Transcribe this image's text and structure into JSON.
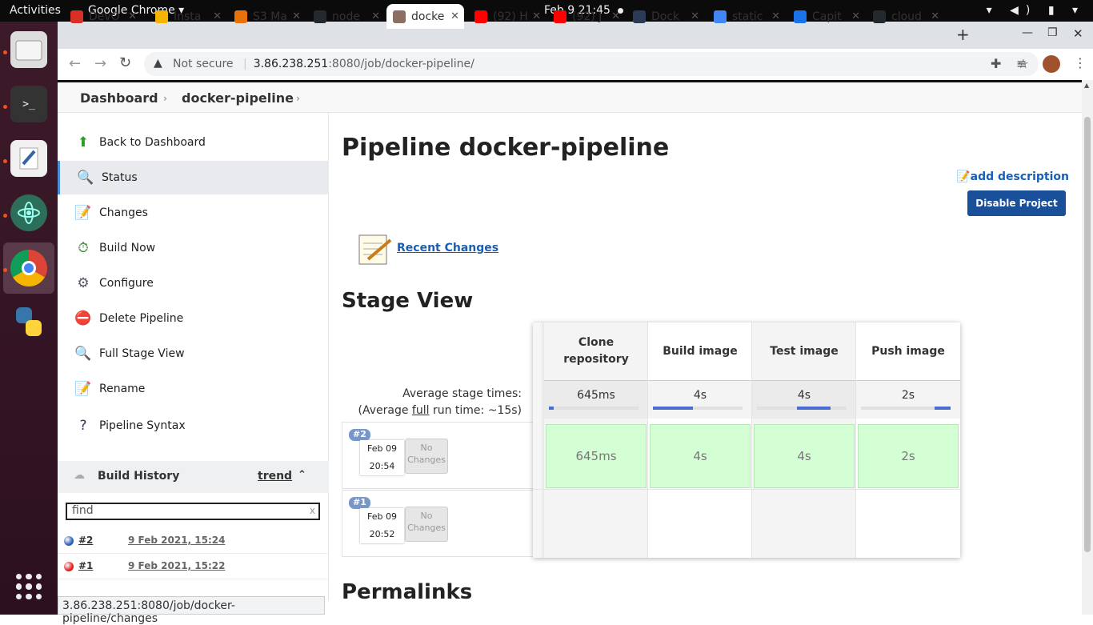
{
  "topbar": {
    "activities": "Activities",
    "app": "Google Chrome ▾",
    "clock": "Feb 9  21:45",
    "sys": "▾ ◀) ▮ ▾"
  },
  "tabs": [
    {
      "label": "DevO",
      "color": "#d93025"
    },
    {
      "label": "Insta",
      "color": "#f4b400"
    },
    {
      "label": "S3 Ma",
      "color": "#e8710a"
    },
    {
      "label": "node",
      "color": "#24292e"
    },
    {
      "label": "docke",
      "color": "#8d6e63"
    },
    {
      "label": "(92) H",
      "color": "#ff0000"
    },
    {
      "label": "(92) J",
      "color": "#ff0000"
    },
    {
      "label": "Dock",
      "color": "#2b3a55"
    },
    {
      "label": "static",
      "color": "#4285f4"
    },
    {
      "label": "Capit",
      "color": "#1a73e8"
    },
    {
      "label": "cloud",
      "color": "#24292e"
    }
  ],
  "address": {
    "not_secure": "Not secure",
    "host": "3.86.238.251",
    "path": ":8080/job/docker-pipeline/"
  },
  "breadcrumb": {
    "dashboard": "Dashboard",
    "job": "docker-pipeline"
  },
  "sidebar": [
    {
      "label": "Back to Dashboard",
      "icon": "arrow-up-icon",
      "glyph": "⬆",
      "color": "#2a9d2a"
    },
    {
      "label": "Status",
      "icon": "magnifier-icon",
      "glyph": "🔍",
      "color": "#555"
    },
    {
      "label": "Changes",
      "icon": "notepad-icon",
      "glyph": "📝",
      "color": "#555"
    },
    {
      "label": "Build Now",
      "icon": "clock-play-icon",
      "glyph": "⏱",
      "color": "#2a7d2a"
    },
    {
      "label": "Configure",
      "icon": "gear-icon",
      "glyph": "⚙",
      "color": "#556"
    },
    {
      "label": "Delete Pipeline",
      "icon": "no-entry-icon",
      "glyph": "⛔",
      "color": "#d22"
    },
    {
      "label": "Full Stage View",
      "icon": "magnifier-icon",
      "glyph": "🔍",
      "color": "#555"
    },
    {
      "label": "Rename",
      "icon": "notepad-icon",
      "glyph": "📝",
      "color": "#555"
    },
    {
      "label": "Pipeline Syntax",
      "icon": "help-icon",
      "glyph": "?",
      "color": "#335"
    }
  ],
  "build_history": {
    "title": "Build History",
    "trend": "trend",
    "find_placeholder": "find",
    "find_clear": "x",
    "builds": [
      {
        "num": "#2",
        "date": "9 Feb 2021, 15:24",
        "color": "#2f5fb8"
      },
      {
        "num": "#1",
        "date": "9 Feb 2021, 15:22",
        "color": "#e02020"
      }
    ]
  },
  "main": {
    "title": "Pipeline docker-pipeline",
    "add_description": "add description",
    "disable": "Disable Project",
    "recent_changes": "Recent Changes",
    "stage_view": "Stage View",
    "permalinks": "Permalinks",
    "avg_line1": "Average stage times:",
    "avg_line2a": "(Average ",
    "avg_full": "full",
    "avg_line2b": " run time: ~15s)"
  },
  "stages": [
    {
      "name": "Clone repository",
      "avg": "645ms",
      "bar_start": 0.0,
      "bar_fill": 0.05,
      "run2": "645ms"
    },
    {
      "name": "Build image",
      "avg": "4s",
      "bar_start": 0.0,
      "bar_fill": 0.45,
      "run2": "4s"
    },
    {
      "name": "Test image",
      "avg": "4s",
      "bar_start": 0.45,
      "bar_fill": 0.37,
      "run2": "4s"
    },
    {
      "name": "Push image",
      "avg": "2s",
      "bar_start": 0.82,
      "bar_fill": 0.18,
      "run2": "2s"
    }
  ],
  "runs": [
    {
      "num": "#2",
      "date": "Feb 09",
      "time": "20:54",
      "changes": "No Changes"
    },
    {
      "num": "#1",
      "date": "Feb 09",
      "time": "20:52",
      "changes": "No Changes"
    }
  ],
  "status_url": "3.86.238.251:8080/job/docker-pipeline/changes"
}
